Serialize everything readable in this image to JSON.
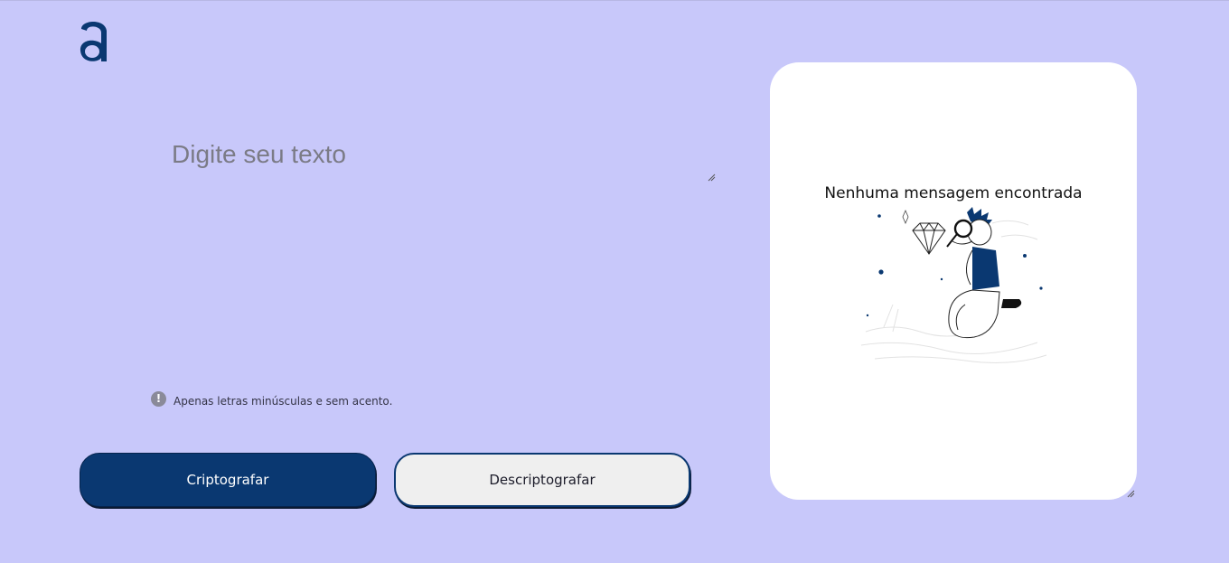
{
  "brand": {
    "logo_icon": "alura-a-logo-icon",
    "color": "#0a3871"
  },
  "editor": {
    "placeholder": "Digite seu texto",
    "value": ""
  },
  "hint": {
    "icon": "exclamation-circle-icon",
    "text": "Apenas letras minúsculas e sem acento."
  },
  "actions": {
    "encrypt_label": "Criptografar",
    "decrypt_label": "Descriptografar"
  },
  "output_panel": {
    "title": "Nenhuma mensagem encontrada",
    "illustration": "person-with-magnifier-illustration"
  },
  "colors": {
    "background": "#c8c8fa",
    "primary": "#0a3871",
    "secondary_button": "#efefef",
    "panel": "#ffffff"
  }
}
